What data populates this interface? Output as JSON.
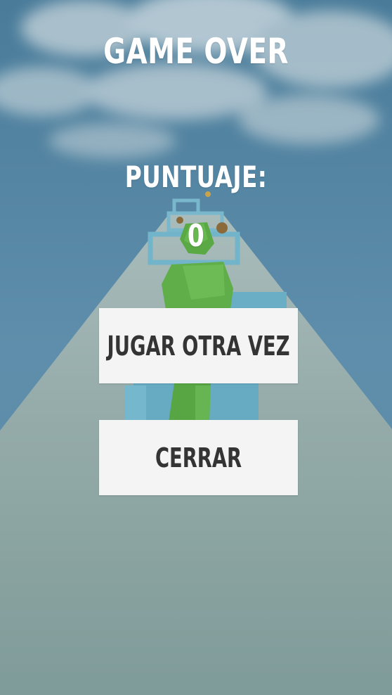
{
  "game_over": {
    "title": "GAME OVER",
    "score_label": "PUNTUAJE:",
    "score_value": "0"
  },
  "buttons": {
    "play_again_label": "JUGAR OTRA VEZ",
    "close_label": "CERRAR"
  },
  "colors": {
    "sky_top": "#4f7f9c",
    "sky_bottom": "#5f8fae",
    "road": "#7f9c9a",
    "road_light": "#a6b8b6",
    "obstacle": "#6fb3c9",
    "player": "#5fa84a",
    "button_bg": "#f4f4f4",
    "button_text": "#343434",
    "hud_text": "#ffffff"
  }
}
